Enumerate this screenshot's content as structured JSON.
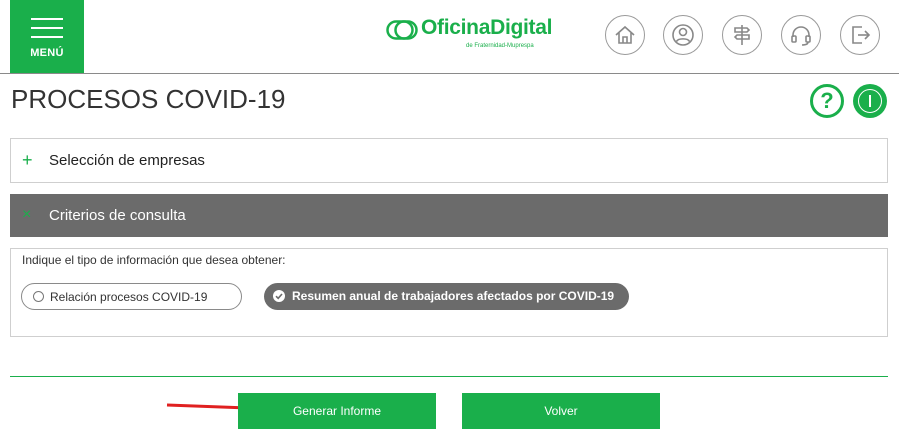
{
  "header": {
    "menu_label": "MENÚ",
    "logo_title": "OficinaDigital",
    "logo_subtitle": "de Fraternidad-Muprespa",
    "nav_icons": [
      "home-icon",
      "user-icon",
      "signpost-icon",
      "headset-icon",
      "logout-icon"
    ]
  },
  "page": {
    "title": "PROCESOS COVID-19",
    "help_symbol": "?"
  },
  "sections": {
    "empresas": {
      "toggle": "+",
      "title": "Selección de empresas"
    },
    "criterios": {
      "toggle": "×",
      "title": "Criterios de consulta"
    }
  },
  "criteria": {
    "prompt": "Indique el tipo de información que desea obtener:",
    "options": [
      {
        "label": "Relación procesos COVID-19",
        "selected": false
      },
      {
        "label": "Resumen anual de trabajadores afectados por COVID-19",
        "selected": true
      }
    ]
  },
  "actions": {
    "generar_label": "Generar Informe",
    "volver_label": "Volver"
  },
  "colors": {
    "brand_green": "#1aaf4b",
    "dark_gray": "#6b6b6b",
    "annotation_red": "#e02020"
  }
}
